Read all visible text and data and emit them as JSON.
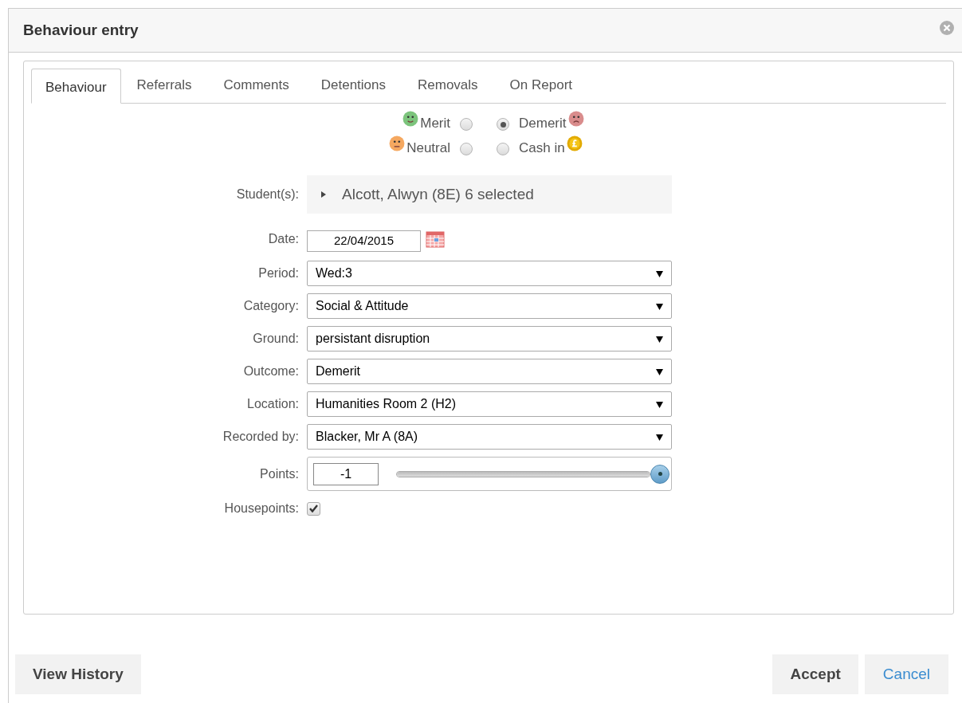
{
  "window": {
    "title": "Behaviour entry"
  },
  "tabs": [
    {
      "label": "Behaviour",
      "selected": true
    },
    {
      "label": "Referrals",
      "selected": false
    },
    {
      "label": "Comments",
      "selected": false
    },
    {
      "label": "Detentions",
      "selected": false
    },
    {
      "label": "Removals",
      "selected": false
    },
    {
      "label": "On Report",
      "selected": false
    }
  ],
  "types": [
    {
      "kind": "merit",
      "label": "Merit",
      "selected": false
    },
    {
      "kind": "demerit",
      "label": "Demerit",
      "selected": true
    },
    {
      "kind": "neutral",
      "label": "Neutral",
      "selected": false
    },
    {
      "kind": "cash",
      "label": "Cash in",
      "selected": false
    }
  ],
  "fields": [
    {
      "kind": "students",
      "label": "Student(s):",
      "value": "Alcott, Alwyn (8E) 6 selected"
    },
    {
      "kind": "date",
      "label": "Date:",
      "value": "22/04/2015"
    },
    {
      "kind": "select",
      "label": "Period:",
      "value": "Wed:3"
    },
    {
      "kind": "select",
      "label": "Category:",
      "value": "Social & Attitude"
    },
    {
      "kind": "select",
      "label": "Ground:",
      "value": "persistant disruption"
    },
    {
      "kind": "select",
      "label": "Outcome:",
      "value": "Demerit"
    },
    {
      "kind": "select",
      "label": "Location:",
      "value": "Humanities Room 2 (H2)"
    },
    {
      "kind": "select",
      "label": "Recorded by:",
      "value": "Blacker, Mr A (8A)"
    },
    {
      "kind": "slider",
      "label": "Points:",
      "value": "-1",
      "level": 1
    },
    {
      "kind": "checkbox",
      "label": "Housepoints:",
      "checked": true
    }
  ],
  "buttons": [
    {
      "kind": "left",
      "label": "View History"
    },
    {
      "kind": "primary",
      "label": "Accept"
    },
    {
      "kind": "link",
      "label": "Cancel"
    }
  ]
}
